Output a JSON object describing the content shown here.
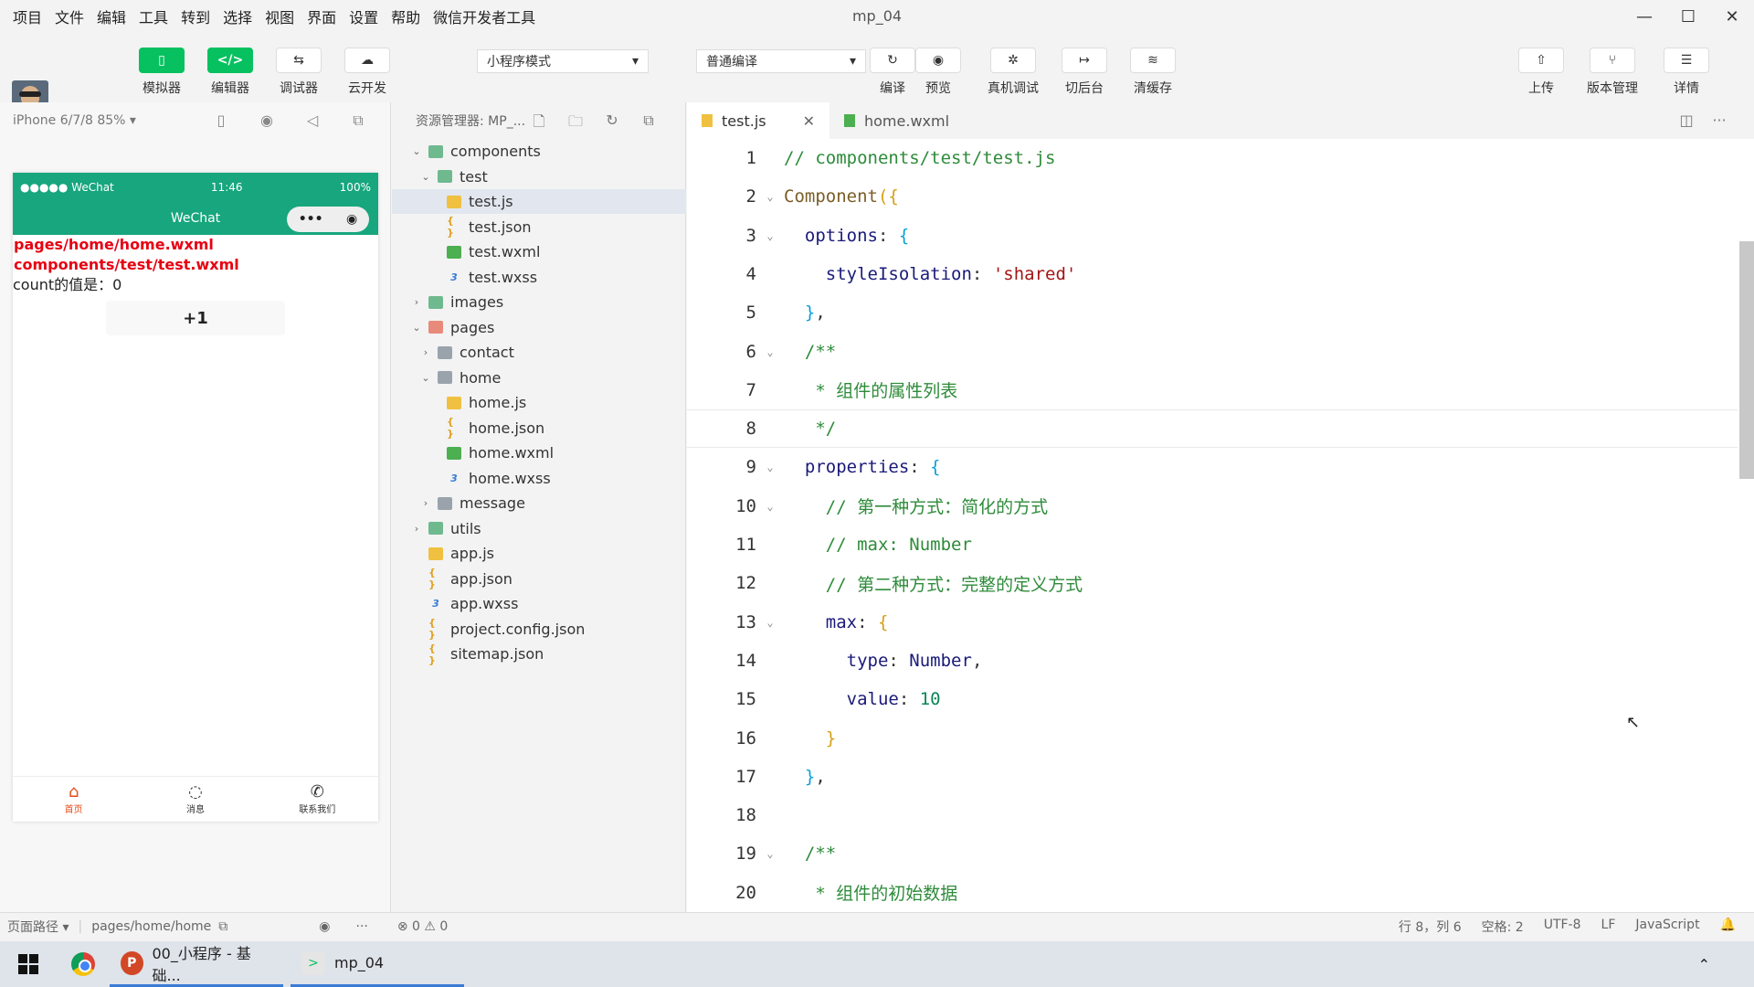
{
  "menubar": {
    "items": [
      "项目",
      "文件",
      "编辑",
      "工具",
      "转到",
      "选择",
      "视图",
      "界面",
      "设置",
      "帮助",
      "微信开发者工具"
    ],
    "title": "mp_04",
    "controls": {
      "minimize": "—",
      "maximize": "☐",
      "close": "✕"
    }
  },
  "toolbar": {
    "simulator": {
      "label": "模拟器",
      "icon": "▯"
    },
    "editor": {
      "label": "编辑器",
      "icon": "</>"
    },
    "debugger": {
      "label": "调试器",
      "icon": "⇆"
    },
    "cloud": {
      "label": "云开发",
      "icon": "☁"
    },
    "mode_select": "小程序模式",
    "compile_select": "普通编译",
    "compile": {
      "label": "编译",
      "icon": "↻"
    },
    "preview": {
      "label": "预览",
      "icon": "◉"
    },
    "remote_debug": {
      "label": "真机调试",
      "icon": "✲"
    },
    "background": {
      "label": "切后台",
      "icon": "↦"
    },
    "clear_cache": {
      "label": "清缓存",
      "icon": "≋"
    },
    "upload": {
      "label": "上传",
      "icon": "⇧"
    },
    "version": {
      "label": "版本管理",
      "icon": "⑂"
    },
    "details": {
      "label": "详情",
      "icon": "☰"
    }
  },
  "simulator": {
    "device": "iPhone 6/7/8 85% ▾",
    "status_left": "●●●●● WeChat",
    "status_time": "11:46",
    "status_right": "100%",
    "nav_title": "WeChat",
    "capsule_dots": "•••",
    "capsule_target": "◉",
    "lines": [
      "pages/home/home.wxml",
      "components/test/test.wxml"
    ],
    "count_text": "count的值是：0",
    "plus_button": "+1",
    "tabs": [
      {
        "label": "首页",
        "icon": "⌂"
      },
      {
        "label": "消息",
        "icon": "◌"
      },
      {
        "label": "联系我们",
        "icon": "✆"
      }
    ]
  },
  "explorer": {
    "title": "资源管理器: MP_...",
    "tree": [
      {
        "label": "components",
        "arrow": "⌄",
        "type": "folder-g",
        "indent": 0
      },
      {
        "label": "test",
        "arrow": "⌄",
        "type": "folder-g",
        "indent": 1
      },
      {
        "label": "test.js",
        "arrow": "",
        "type": "js",
        "indent": 2,
        "selected": true
      },
      {
        "label": "test.json",
        "arrow": "",
        "type": "json",
        "indent": 2
      },
      {
        "label": "test.wxml",
        "arrow": "",
        "type": "wxml",
        "indent": 2
      },
      {
        "label": "test.wxss",
        "arrow": "",
        "type": "wxss",
        "indent": 2
      },
      {
        "label": "images",
        "arrow": "›",
        "type": "folder-g",
        "indent": 0
      },
      {
        "label": "pages",
        "arrow": "⌄",
        "type": "folder-r",
        "indent": 0
      },
      {
        "label": "contact",
        "arrow": "›",
        "type": "folder",
        "indent": 1
      },
      {
        "label": "home",
        "arrow": "⌄",
        "type": "folder",
        "indent": 1
      },
      {
        "label": "home.js",
        "arrow": "",
        "type": "js",
        "indent": 2
      },
      {
        "label": "home.json",
        "arrow": "",
        "type": "json",
        "indent": 2
      },
      {
        "label": "home.wxml",
        "arrow": "",
        "type": "wxml",
        "indent": 2
      },
      {
        "label": "home.wxss",
        "arrow": "",
        "type": "wxss",
        "indent": 2
      },
      {
        "label": "message",
        "arrow": "›",
        "type": "folder",
        "indent": 1
      },
      {
        "label": "utils",
        "arrow": "›",
        "type": "folder-g",
        "indent": 0
      },
      {
        "label": "app.js",
        "arrow": "",
        "type": "js",
        "indent": 0
      },
      {
        "label": "app.json",
        "arrow": "",
        "type": "json",
        "indent": 0
      },
      {
        "label": "app.wxss",
        "arrow": "",
        "type": "wxss",
        "indent": 0
      },
      {
        "label": "project.config.json",
        "arrow": "",
        "type": "json",
        "indent": 0
      },
      {
        "label": "sitemap.json",
        "arrow": "",
        "type": "json",
        "indent": 0
      }
    ]
  },
  "editor": {
    "tabs": [
      {
        "label": "test.js",
        "active": true,
        "close": "✕"
      },
      {
        "label": "home.wxml",
        "active": false
      }
    ],
    "lines": [
      {
        "n": "1",
        "fold": "",
        "tokens": [
          [
            "c-com",
            "// components/test/test.js"
          ]
        ]
      },
      {
        "n": "2",
        "fold": "⌄",
        "tokens": [
          [
            "c-fn",
            "Component"
          ],
          [
            "c-br2",
            "({"
          ]
        ]
      },
      {
        "n": "3",
        "fold": "⌄",
        "tokens": [
          [
            "",
            "  "
          ],
          [
            "c-key",
            "options"
          ],
          [
            "",
            ": "
          ],
          [
            "c-br",
            "{"
          ]
        ]
      },
      {
        "n": "4",
        "fold": "",
        "tokens": [
          [
            "",
            "    "
          ],
          [
            "c-key",
            "styleIsolation"
          ],
          [
            "",
            ": "
          ],
          [
            "c-str",
            "'shared'"
          ]
        ]
      },
      {
        "n": "5",
        "fold": "",
        "tokens": [
          [
            "",
            "  "
          ],
          [
            "c-br",
            "}"
          ],
          [
            "",
            ","
          ]
        ]
      },
      {
        "n": "6",
        "fold": "⌄",
        "tokens": [
          [
            "c-com",
            "  /**"
          ]
        ]
      },
      {
        "n": "7",
        "fold": "",
        "tokens": [
          [
            "c-com",
            "   * 组件的属性列表"
          ]
        ]
      },
      {
        "n": "8",
        "fold": "",
        "tokens": [
          [
            "c-com",
            "   */"
          ]
        ],
        "current": true
      },
      {
        "n": "9",
        "fold": "⌄",
        "tokens": [
          [
            "",
            "  "
          ],
          [
            "c-key",
            "properties"
          ],
          [
            "",
            ": "
          ],
          [
            "c-br",
            "{"
          ]
        ]
      },
      {
        "n": "10",
        "fold": "⌄",
        "tokens": [
          [
            "c-com",
            "    // 第一种方式：简化的方式"
          ]
        ]
      },
      {
        "n": "11",
        "fold": "",
        "tokens": [
          [
            "c-com",
            "    // max: Number"
          ]
        ]
      },
      {
        "n": "12",
        "fold": "",
        "tokens": [
          [
            "c-com",
            "    // 第二种方式：完整的定义方式"
          ]
        ]
      },
      {
        "n": "13",
        "fold": "⌄",
        "tokens": [
          [
            "",
            "    "
          ],
          [
            "c-key",
            "max"
          ],
          [
            "",
            ": "
          ],
          [
            "c-br2",
            "{"
          ]
        ]
      },
      {
        "n": "14",
        "fold": "",
        "tokens": [
          [
            "",
            "      "
          ],
          [
            "c-key",
            "type"
          ],
          [
            "",
            ": "
          ],
          [
            "c-key",
            "Number"
          ],
          [
            "",
            ","
          ]
        ]
      },
      {
        "n": "15",
        "fold": "",
        "tokens": [
          [
            "",
            "      "
          ],
          [
            "c-key",
            "value"
          ],
          [
            "",
            ": "
          ],
          [
            "c-num",
            "10"
          ]
        ]
      },
      {
        "n": "16",
        "fold": "",
        "tokens": [
          [
            "",
            "    "
          ],
          [
            "c-br2",
            "}"
          ]
        ]
      },
      {
        "n": "17",
        "fold": "",
        "tokens": [
          [
            "",
            "  "
          ],
          [
            "c-br",
            "}"
          ],
          [
            "",
            ","
          ]
        ]
      },
      {
        "n": "18",
        "fold": "",
        "tokens": [
          [
            "",
            ""
          ]
        ]
      },
      {
        "n": "19",
        "fold": "⌄",
        "tokens": [
          [
            "c-com",
            "  /**"
          ]
        ]
      },
      {
        "n": "20",
        "fold": "",
        "tokens": [
          [
            "c-com",
            "   * 组件的初始数据"
          ]
        ]
      }
    ]
  },
  "statusbar": {
    "page_path_label": "页面路径 ▾",
    "page_path": "pages/home/home",
    "errors": "⊗ 0 ⚠ 0",
    "position": "行 8，列 6",
    "spaces": "空格: 2",
    "encoding": "UTF-8",
    "eol": "LF",
    "language": "JavaScript",
    "bell": "🔔"
  },
  "taskbar": {
    "ppt_label": "00_小程序 - 基础...",
    "wx_label": "mp_04",
    "tray": "⌃"
  }
}
